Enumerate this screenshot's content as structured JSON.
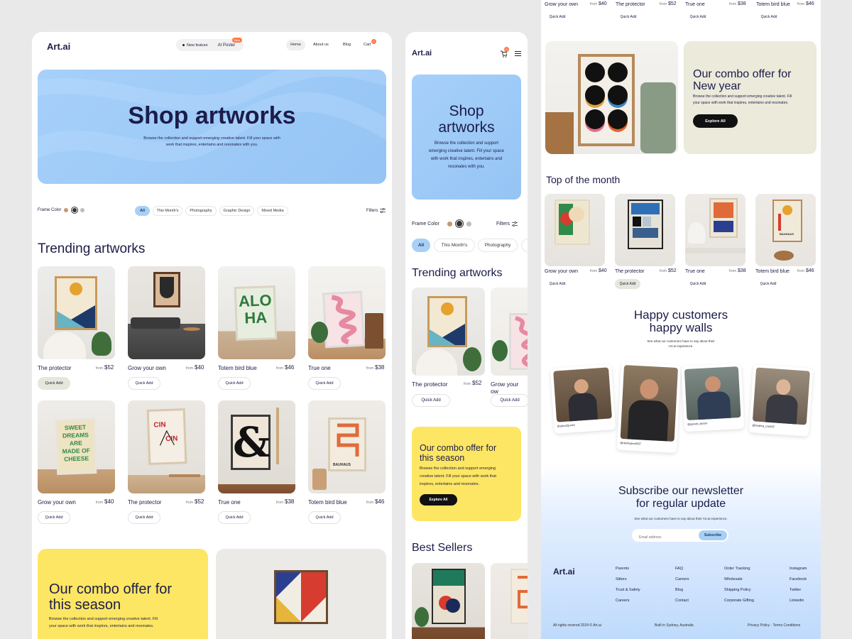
{
  "left": {
    "logo": "Art.ai",
    "feature_badge": "New feature",
    "ai_poster": "AI Poster",
    "ai_poster_badge": "New",
    "nav": [
      "Home",
      "About us",
      "Blog",
      "Cart"
    ],
    "cart_count": "0",
    "hero_title": "Shop artworks",
    "hero_text_1": "Browse the collection and support emerging creative talent. Fill your space with",
    "hero_text_2": "work that inspires, entertains and resonates with you.",
    "frame_color_label": "Frame Color",
    "filters": [
      "All",
      "This Month's",
      "Photography",
      "Graphic Design",
      "Mixed Media"
    ],
    "filters_label": "Filters",
    "section_title": "Trending artworks",
    "products": [
      {
        "name": "The protector",
        "from": "from",
        "price": "$52",
        "cta": "Quick Add"
      },
      {
        "name": "Grow your own",
        "from": "from",
        "price": "$40",
        "cta": "Quick Add"
      },
      {
        "name": "Totem bird blue",
        "from": "from",
        "price": "$46",
        "cta": "Quick Add"
      },
      {
        "name": "True one",
        "from": "from",
        "price": "$38",
        "cta": "Quick Add"
      },
      {
        "name": "Grow your own",
        "from": "from",
        "price": "$40",
        "cta": "Quick Add"
      },
      {
        "name": "The protector",
        "from": "from",
        "price": "$52",
        "cta": "Quick Add"
      },
      {
        "name": "True one",
        "from": "from",
        "price": "$38",
        "cta": "Quick Add"
      },
      {
        "name": "Totem bird blue",
        "from": "from",
        "price": "$46",
        "cta": "Quick Add"
      }
    ],
    "art_text": {
      "alo": "ALO",
      "ha": "HA",
      "sweet": "SWEET",
      "dreams": "DREAMS",
      "are": "ARE",
      "made_of": "MADE OF",
      "cheese": "CHEESE",
      "cin": "CIN",
      "amp": "&",
      "bauhaus": "BAUHAUS"
    },
    "combo_title_1": "Our combo offer for",
    "combo_title_2": "this season",
    "combo_text_1": "Browse the collection and support emerging creative talent. Fill",
    "combo_text_2": "your space with work that inspires, entertains and resonates."
  },
  "mobile": {
    "logo": "Art.ai",
    "cart_count": "0",
    "hero_title_1": "Shop",
    "hero_title_2": "artworks",
    "hero_text": [
      "Browse the collection and support",
      "emerging creative talent. Fill your space",
      "with work that inspires, entertains and",
      "resonates with you."
    ],
    "frame_color_label": "Frame Color",
    "filters_label": "Filters",
    "chips": [
      "All",
      "This Month's",
      "Photography"
    ],
    "section_title": "Trending artworks",
    "products": [
      {
        "name": "The protector",
        "from": "from",
        "price": "$52",
        "cta": "Quick Add"
      },
      {
        "name": "Grow your ow",
        "cta": "Quick Add"
      }
    ],
    "combo_title_1": "Our combo offer for",
    "combo_title_2": "this season",
    "combo_text": [
      "Browse the collection and support emerging",
      "creative talent. Fill your space with work that",
      "inspires, entertains and resonates."
    ],
    "combo_cta": "Explore All",
    "best_sellers": "Best Sellers"
  },
  "right": {
    "top_strip": [
      {
        "name": "Grow your own",
        "from": "from",
        "price": "$40",
        "cta": "Quick Add"
      },
      {
        "name": "The protector",
        "from": "from",
        "price": "$52",
        "cta": "Quick Add"
      },
      {
        "name": "True one",
        "from": "from",
        "price": "$38",
        "cta": "Quick Add"
      },
      {
        "name": "Totem bird blue",
        "from": "from",
        "price": "$46",
        "cta": "Quick Add"
      }
    ],
    "combo_title_1": "Our combo offer for",
    "combo_title_2": "New year",
    "combo_text_1": "Browse the collection and support emerging creative talent. Fill",
    "combo_text_2": "your space with work that inspires, entertains and resonates.",
    "combo_cta": "Explore All",
    "top_month_title": "Top of the month",
    "top_month": [
      {
        "name": "Grow your own",
        "from": "from",
        "price": "$40",
        "cta": "Quick Add"
      },
      {
        "name": "The protector",
        "from": "from",
        "price": "$52",
        "cta": "Quick Add"
      },
      {
        "name": "True one",
        "from": "from",
        "price": "$38",
        "cta": "Quick Add"
      },
      {
        "name": "Totem bird blue",
        "from": "from",
        "price": "$46",
        "cta": "Quick Add"
      }
    ],
    "totem_art_label": "BAUHAUS",
    "testimonials_title_1": "Happy customers",
    "testimonials_title_2": "happy walls",
    "testimonials_sub_1": "See what our customers have to say about their",
    "testimonials_sub_2": "Art.ai experience.",
    "handles": [
      "@alecobjones",
      "@danksjeuel007",
      "@jackob_bsson",
      "@tmaliva_ore345"
    ],
    "newsletter_title_1": "Subscribe our newsletter",
    "newsletter_title_2": "for regular update",
    "newsletter_sub": "See what our customers have to say about their Art.ai experience.",
    "email_placeholder": "Email address",
    "subscribe": "Subscribe",
    "footer_logo": "Art.ai",
    "footer_cols": [
      [
        "Parents",
        "Sitters",
        "Trust & Safety",
        "Careers"
      ],
      [
        "FAQ",
        "Careers",
        "Blog",
        "Contact"
      ],
      [
        "Order Tracking",
        "Wholesale",
        "Shipping Policy",
        "Corporate Gifting"
      ],
      [
        "Instagram",
        "Facebook",
        "Twitter",
        "Linkedin"
      ]
    ],
    "copyright": "All rights revered 2024 © Art.ai",
    "built_in": "Built in Sydney, Australia",
    "legal": "Privacy Policy · Terms Conditions"
  }
}
